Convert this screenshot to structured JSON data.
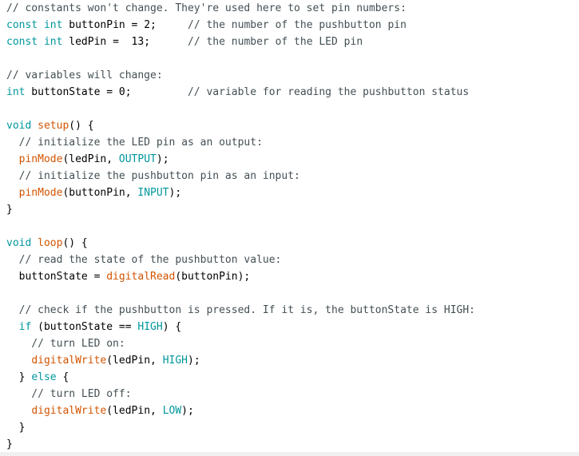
{
  "colors": {
    "comment": "#434f54",
    "keyword": "#00979c",
    "function": "#d35400",
    "literal": "#00979c",
    "text": "#000000",
    "background": "#ffffff"
  },
  "code": {
    "lines": [
      [
        {
          "t": "cmt",
          "v": "// constants won't change. They're used here to set pin numbers:"
        }
      ],
      [
        {
          "t": "kw",
          "v": "const"
        },
        {
          "t": "txt",
          "v": " "
        },
        {
          "t": "kw",
          "v": "int"
        },
        {
          "t": "txt",
          "v": " buttonPin = 2;     "
        },
        {
          "t": "cmt",
          "v": "// the number of the pushbutton pin"
        }
      ],
      [
        {
          "t": "kw",
          "v": "const"
        },
        {
          "t": "txt",
          "v": " "
        },
        {
          "t": "kw",
          "v": "int"
        },
        {
          "t": "txt",
          "v": " ledPin =  13;      "
        },
        {
          "t": "cmt",
          "v": "// the number of the LED pin"
        }
      ],
      [],
      [
        {
          "t": "cmt",
          "v": "// variables will change:"
        }
      ],
      [
        {
          "t": "kw",
          "v": "int"
        },
        {
          "t": "txt",
          "v": " buttonState = 0;         "
        },
        {
          "t": "cmt",
          "v": "// variable for reading the pushbutton status"
        }
      ],
      [],
      [
        {
          "t": "kw",
          "v": "void"
        },
        {
          "t": "txt",
          "v": " "
        },
        {
          "t": "fn",
          "v": "setup"
        },
        {
          "t": "txt",
          "v": "() {"
        }
      ],
      [
        {
          "t": "cmt",
          "v": "  // initialize the LED pin as an output:"
        }
      ],
      [
        {
          "t": "txt",
          "v": "  "
        },
        {
          "t": "fn",
          "v": "pinMode"
        },
        {
          "t": "txt",
          "v": "(ledPin, "
        },
        {
          "t": "lit",
          "v": "OUTPUT"
        },
        {
          "t": "txt",
          "v": ");"
        }
      ],
      [
        {
          "t": "cmt",
          "v": "  // initialize the pushbutton pin as an input:"
        }
      ],
      [
        {
          "t": "txt",
          "v": "  "
        },
        {
          "t": "fn",
          "v": "pinMode"
        },
        {
          "t": "txt",
          "v": "(buttonPin, "
        },
        {
          "t": "lit",
          "v": "INPUT"
        },
        {
          "t": "txt",
          "v": ");"
        }
      ],
      [
        {
          "t": "txt",
          "v": "}"
        }
      ],
      [],
      [
        {
          "t": "kw",
          "v": "void"
        },
        {
          "t": "txt",
          "v": " "
        },
        {
          "t": "fn",
          "v": "loop"
        },
        {
          "t": "txt",
          "v": "() {"
        }
      ],
      [
        {
          "t": "cmt",
          "v": "  // read the state of the pushbutton value:"
        }
      ],
      [
        {
          "t": "txt",
          "v": "  buttonState = "
        },
        {
          "t": "fn",
          "v": "digitalRead"
        },
        {
          "t": "txt",
          "v": "(buttonPin);"
        }
      ],
      [],
      [
        {
          "t": "cmt",
          "v": "  // check if the pushbutton is pressed. If it is, the buttonState is HIGH:"
        }
      ],
      [
        {
          "t": "txt",
          "v": "  "
        },
        {
          "t": "kw",
          "v": "if"
        },
        {
          "t": "txt",
          "v": " (buttonState == "
        },
        {
          "t": "lit",
          "v": "HIGH"
        },
        {
          "t": "txt",
          "v": ") {"
        }
      ],
      [
        {
          "t": "cmt",
          "v": "    // turn LED on:"
        }
      ],
      [
        {
          "t": "txt",
          "v": "    "
        },
        {
          "t": "fn",
          "v": "digitalWrite"
        },
        {
          "t": "txt",
          "v": "(ledPin, "
        },
        {
          "t": "lit",
          "v": "HIGH"
        },
        {
          "t": "txt",
          "v": ");"
        }
      ],
      [
        {
          "t": "txt",
          "v": "  } "
        },
        {
          "t": "kw",
          "v": "else"
        },
        {
          "t": "txt",
          "v": " {"
        }
      ],
      [
        {
          "t": "cmt",
          "v": "    // turn LED off:"
        }
      ],
      [
        {
          "t": "txt",
          "v": "    "
        },
        {
          "t": "fn",
          "v": "digitalWrite"
        },
        {
          "t": "txt",
          "v": "(ledPin, "
        },
        {
          "t": "lit",
          "v": "LOW"
        },
        {
          "t": "txt",
          "v": ");"
        }
      ],
      [
        {
          "t": "txt",
          "v": "  }"
        }
      ],
      [
        {
          "t": "txt",
          "v": "}"
        }
      ]
    ]
  }
}
